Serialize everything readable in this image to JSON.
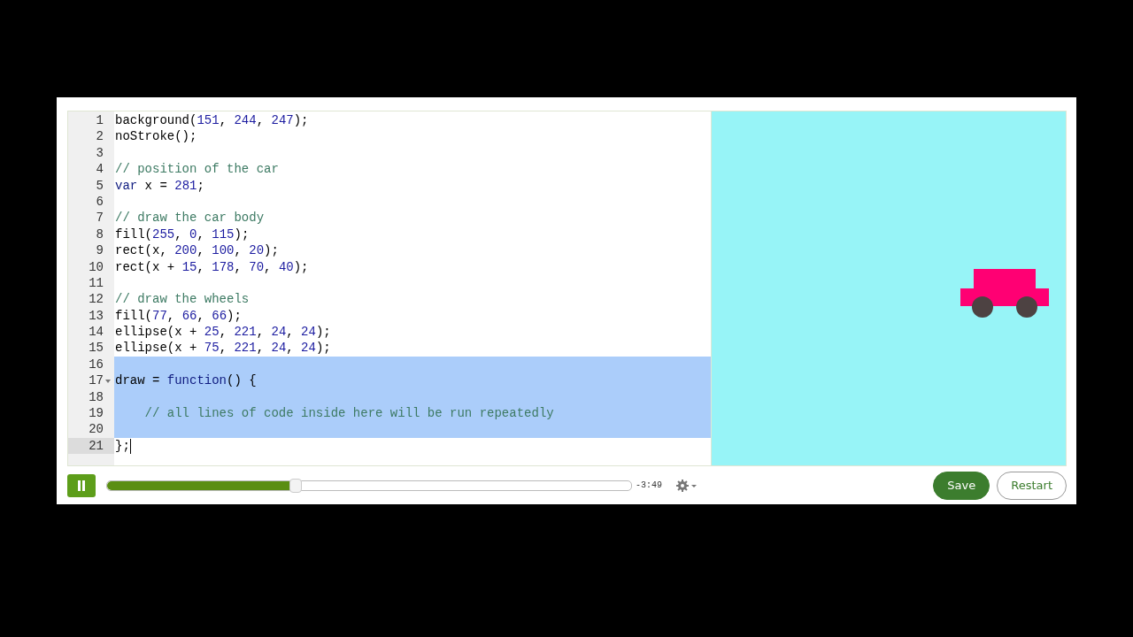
{
  "editor": {
    "lines": [
      {
        "number": "1",
        "selected": false,
        "active": false,
        "foldable": false,
        "tokens": [
          {
            "kind": "plain",
            "t": "background("
          },
          {
            "kind": "num",
            "t": "151"
          },
          {
            "kind": "plain",
            "t": ", "
          },
          {
            "kind": "num",
            "t": "244"
          },
          {
            "kind": "plain",
            "t": ", "
          },
          {
            "kind": "num",
            "t": "247"
          },
          {
            "kind": "plain",
            "t": ");"
          }
        ]
      },
      {
        "number": "2",
        "selected": false,
        "active": false,
        "foldable": false,
        "tokens": [
          {
            "kind": "plain",
            "t": "noStroke();"
          }
        ]
      },
      {
        "number": "3",
        "selected": false,
        "active": false,
        "foldable": false
      },
      {
        "number": "4",
        "selected": false,
        "active": false,
        "foldable": false,
        "tokens": [
          {
            "kind": "comment",
            "t": "// position of the car"
          }
        ]
      },
      {
        "number": "5",
        "selected": false,
        "active": false,
        "foldable": false,
        "tokens": [
          {
            "kind": "kw",
            "t": "var"
          },
          {
            "kind": "plain",
            "t": " x = "
          },
          {
            "kind": "num",
            "t": "281"
          },
          {
            "kind": "plain",
            "t": ";"
          }
        ]
      },
      {
        "number": "6",
        "selected": false,
        "active": false,
        "foldable": false
      },
      {
        "number": "7",
        "selected": false,
        "active": false,
        "foldable": false,
        "tokens": [
          {
            "kind": "comment",
            "t": "// draw the car body"
          }
        ]
      },
      {
        "number": "8",
        "selected": false,
        "active": false,
        "foldable": false,
        "tokens": [
          {
            "kind": "plain",
            "t": "fill("
          },
          {
            "kind": "num",
            "t": "255"
          },
          {
            "kind": "plain",
            "t": ", "
          },
          {
            "kind": "num",
            "t": "0"
          },
          {
            "kind": "plain",
            "t": ", "
          },
          {
            "kind": "num",
            "t": "115"
          },
          {
            "kind": "plain",
            "t": ");"
          }
        ]
      },
      {
        "number": "9",
        "selected": false,
        "active": false,
        "foldable": false,
        "tokens": [
          {
            "kind": "plain",
            "t": "rect(x, "
          },
          {
            "kind": "num",
            "t": "200"
          },
          {
            "kind": "plain",
            "t": ", "
          },
          {
            "kind": "num",
            "t": "100"
          },
          {
            "kind": "plain",
            "t": ", "
          },
          {
            "kind": "num",
            "t": "20"
          },
          {
            "kind": "plain",
            "t": ");"
          }
        ]
      },
      {
        "number": "10",
        "selected": false,
        "active": false,
        "foldable": false,
        "tokens": [
          {
            "kind": "plain",
            "t": "rect(x + "
          },
          {
            "kind": "num",
            "t": "15"
          },
          {
            "kind": "plain",
            "t": ", "
          },
          {
            "kind": "num",
            "t": "178"
          },
          {
            "kind": "plain",
            "t": ", "
          },
          {
            "kind": "num",
            "t": "70"
          },
          {
            "kind": "plain",
            "t": ", "
          },
          {
            "kind": "num",
            "t": "40"
          },
          {
            "kind": "plain",
            "t": ");"
          }
        ]
      },
      {
        "number": "11",
        "selected": false,
        "active": false,
        "foldable": false
      },
      {
        "number": "12",
        "selected": false,
        "active": false,
        "foldable": false,
        "tokens": [
          {
            "kind": "comment",
            "t": "// draw the wheels"
          }
        ]
      },
      {
        "number": "13",
        "selected": false,
        "active": false,
        "foldable": false,
        "tokens": [
          {
            "kind": "plain",
            "t": "fill("
          },
          {
            "kind": "num",
            "t": "77"
          },
          {
            "kind": "plain",
            "t": ", "
          },
          {
            "kind": "num",
            "t": "66"
          },
          {
            "kind": "plain",
            "t": ", "
          },
          {
            "kind": "num",
            "t": "66"
          },
          {
            "kind": "plain",
            "t": ");"
          }
        ]
      },
      {
        "number": "14",
        "selected": false,
        "active": false,
        "foldable": false,
        "tokens": [
          {
            "kind": "plain",
            "t": "ellipse(x + "
          },
          {
            "kind": "num",
            "t": "25"
          },
          {
            "kind": "plain",
            "t": ", "
          },
          {
            "kind": "num",
            "t": "221"
          },
          {
            "kind": "plain",
            "t": ", "
          },
          {
            "kind": "num",
            "t": "24"
          },
          {
            "kind": "plain",
            "t": ", "
          },
          {
            "kind": "num",
            "t": "24"
          },
          {
            "kind": "plain",
            "t": ");"
          }
        ]
      },
      {
        "number": "15",
        "selected": false,
        "active": false,
        "foldable": false,
        "tokens": [
          {
            "kind": "plain",
            "t": "ellipse(x + "
          },
          {
            "kind": "num",
            "t": "75"
          },
          {
            "kind": "plain",
            "t": ", "
          },
          {
            "kind": "num",
            "t": "221"
          },
          {
            "kind": "plain",
            "t": ", "
          },
          {
            "kind": "num",
            "t": "24"
          },
          {
            "kind": "plain",
            "t": ", "
          },
          {
            "kind": "num",
            "t": "24"
          },
          {
            "kind": "plain",
            "t": ");"
          }
        ]
      },
      {
        "number": "16",
        "selected": true,
        "active": false,
        "foldable": false
      },
      {
        "number": "17",
        "selected": true,
        "active": false,
        "foldable": true,
        "tokens": [
          {
            "kind": "plain",
            "t": "draw = "
          },
          {
            "kind": "kw",
            "t": "function"
          },
          {
            "kind": "plain",
            "t": "() {"
          }
        ]
      },
      {
        "number": "18",
        "selected": true,
        "active": false,
        "foldable": false
      },
      {
        "number": "19",
        "selected": true,
        "active": false,
        "foldable": false,
        "tokens": [
          {
            "kind": "comment",
            "t": "    // all lines of code inside here will be run repeatedly"
          }
        ]
      },
      {
        "number": "20",
        "selected": true,
        "active": false,
        "foldable": false
      },
      {
        "number": "21",
        "selected": false,
        "active": true,
        "foldable": false,
        "tokens": [
          {
            "kind": "plain",
            "t": "};"
          }
        ]
      }
    ]
  },
  "player": {
    "playing": true,
    "level": 0.36,
    "time": "-3:49"
  },
  "buttons": [
    {
      "label": "Save",
      "kind": "primary"
    },
    {
      "label": "Restart",
      "kind": "secondary"
    }
  ]
}
